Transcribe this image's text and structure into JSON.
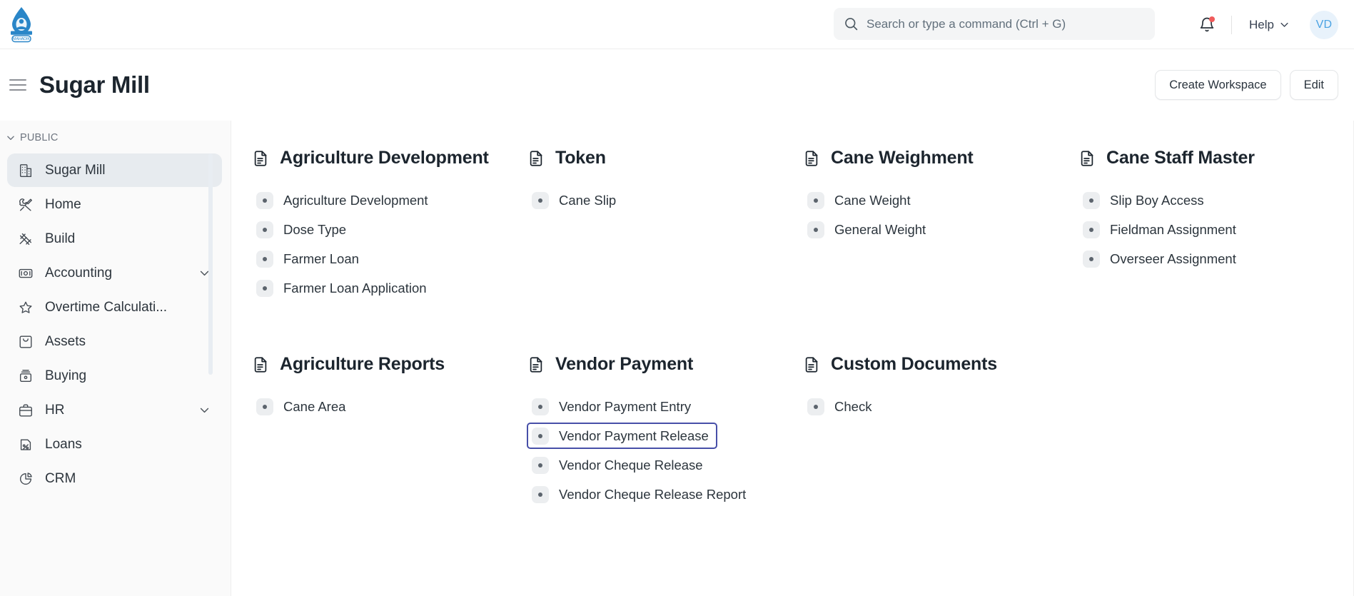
{
  "navbar": {
    "logo_alt": "Mahadik sugar mill logo",
    "search": {
      "placeholder": "Search or type a command (Ctrl + G)",
      "value": ""
    },
    "notification_icon": "bell-icon",
    "has_unread": true,
    "help_label": "Help",
    "avatar_initials": "VD"
  },
  "page": {
    "title": "Sugar Mill",
    "create_workspace_label": "Create Workspace",
    "edit_label": "Edit"
  },
  "sidebar": {
    "section_label": "PUBLIC",
    "items": [
      {
        "label": "Sugar Mill",
        "icon": "building-icon",
        "active": true,
        "caret": false
      },
      {
        "label": "Home",
        "icon": "tools-icon",
        "active": false,
        "caret": false
      },
      {
        "label": "Build",
        "icon": "hammer-icon",
        "active": false,
        "caret": false
      },
      {
        "label": "Accounting",
        "icon": "money-icon",
        "active": false,
        "caret": true
      },
      {
        "label": "Overtime Calculati...",
        "icon": "star-icon",
        "active": false,
        "caret": false
      },
      {
        "label": "Assets",
        "icon": "box-icon",
        "active": false,
        "caret": false
      },
      {
        "label": "Buying",
        "icon": "cart-icon",
        "active": false,
        "caret": false
      },
      {
        "label": "HR",
        "icon": "briefcase-icon",
        "active": false,
        "caret": true
      },
      {
        "label": "Loans",
        "icon": "loan-icon",
        "active": false,
        "caret": false
      },
      {
        "label": "CRM",
        "icon": "piechart-icon",
        "active": false,
        "caret": false
      }
    ]
  },
  "content": {
    "rows": [
      [
        {
          "title": "Agriculture Development",
          "icon": "document-icon",
          "links": [
            {
              "label": "Agriculture Development",
              "highlighted": false
            },
            {
              "label": "Dose Type",
              "highlighted": false
            },
            {
              "label": "Farmer Loan",
              "highlighted": false
            },
            {
              "label": "Farmer Loan Application",
              "highlighted": false
            }
          ]
        },
        {
          "title": "Token",
          "icon": "document-icon",
          "links": [
            {
              "label": "Cane Slip",
              "highlighted": false
            }
          ]
        },
        {
          "title": "Cane Weighment",
          "icon": "document-icon",
          "links": [
            {
              "label": "Cane Weight",
              "highlighted": false
            },
            {
              "label": "General Weight",
              "highlighted": false
            }
          ]
        },
        {
          "title": "Cane Staff Master",
          "icon": "document-icon",
          "links": [
            {
              "label": "Slip Boy Access",
              "highlighted": false
            },
            {
              "label": "Fieldman Assignment",
              "highlighted": false
            },
            {
              "label": "Overseer Assignment",
              "highlighted": false
            }
          ]
        }
      ],
      [
        {
          "title": "Agriculture Reports",
          "icon": "document-icon",
          "links": [
            {
              "label": "Cane Area",
              "highlighted": false
            }
          ]
        },
        {
          "title": "Vendor Payment",
          "icon": "document-icon",
          "links": [
            {
              "label": "Vendor Payment Entry",
              "highlighted": false
            },
            {
              "label": "Vendor Payment Release",
              "highlighted": true
            },
            {
              "label": "Vendor Cheque Release",
              "highlighted": false
            },
            {
              "label": "Vendor Cheque Release Report",
              "highlighted": false
            }
          ]
        },
        {
          "title": "Custom Documents",
          "icon": "document-icon",
          "links": [
            {
              "label": "Check",
              "highlighted": false
            }
          ]
        }
      ]
    ]
  },
  "colors": {
    "highlight_border": "#474fa8",
    "accent_avatar": "#4ba3e3",
    "notification_dot": "#f05b5b",
    "sidebar_active_bg": "#e7ebef",
    "bullet_bg": "#eceef0"
  }
}
